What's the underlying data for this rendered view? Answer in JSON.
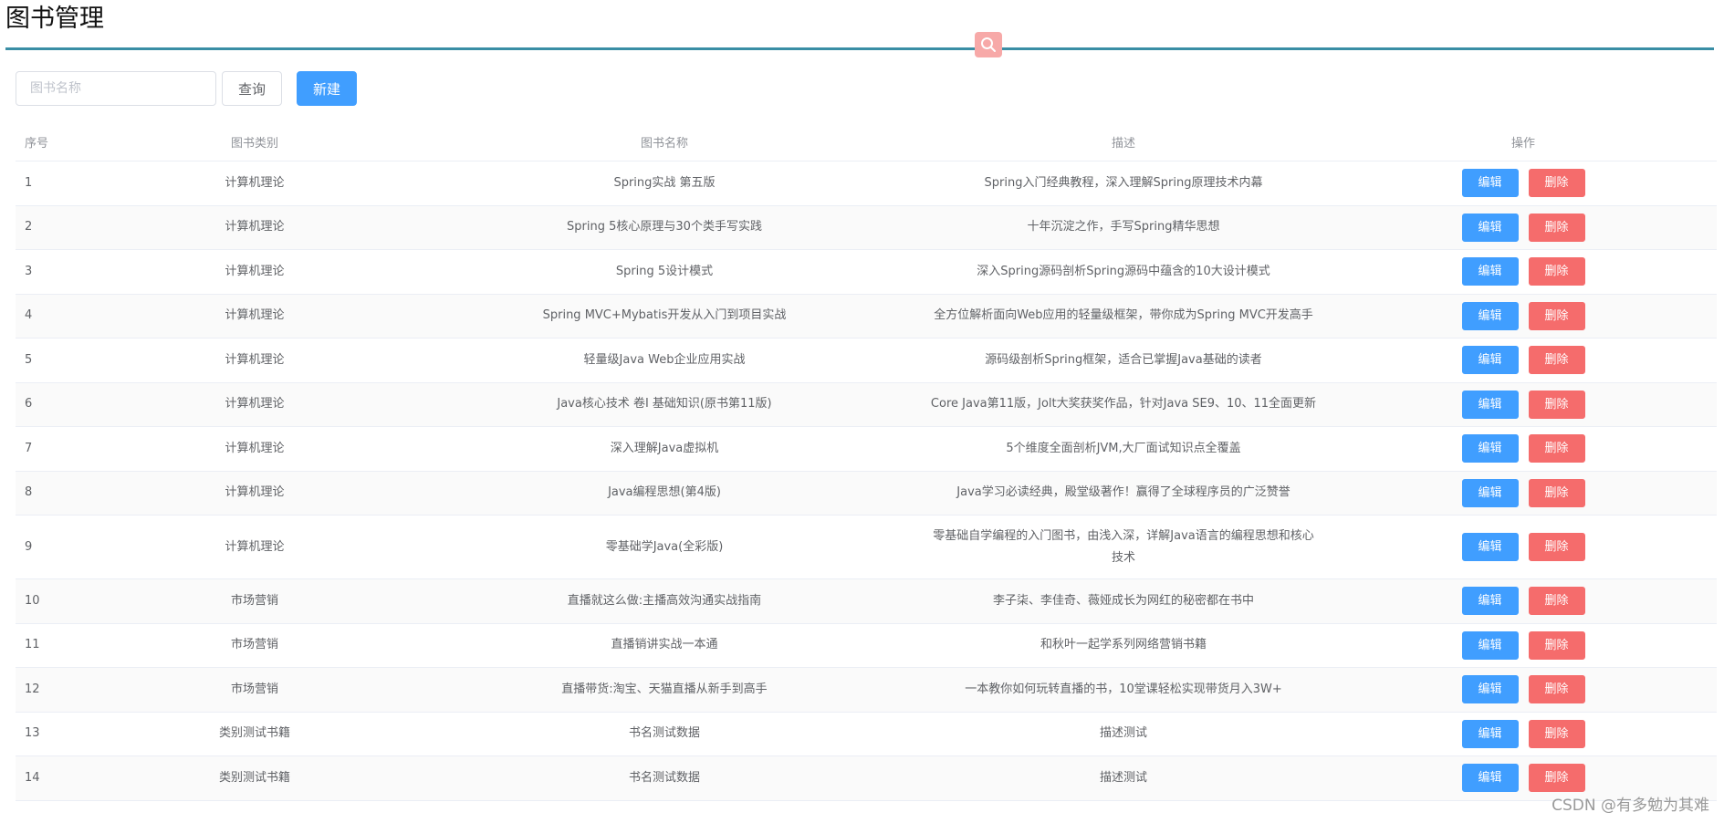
{
  "page": {
    "title": "图书管理"
  },
  "toolbar": {
    "search_placeholder": "图书名称",
    "search_value": "",
    "query_label": "查询",
    "new_label": "新建"
  },
  "table": {
    "columns": [
      "序号",
      "图书类别",
      "图书名称",
      "描述",
      "操作"
    ],
    "edit_label": "编辑",
    "delete_label": "删除",
    "rows": [
      {
        "index": "1",
        "category": "计算机理论",
        "name": "Spring实战 第五版",
        "desc": "Spring入门经典教程，深入理解Spring原理技术内幕"
      },
      {
        "index": "2",
        "category": "计算机理论",
        "name": "Spring 5核心原理与30个类手写实践",
        "desc": "十年沉淀之作，手写Spring精华思想"
      },
      {
        "index": "3",
        "category": "计算机理论",
        "name": "Spring 5设计模式",
        "desc": "深入Spring源码剖析Spring源码中蕴含的10大设计模式"
      },
      {
        "index": "4",
        "category": "计算机理论",
        "name": "Spring MVC+Mybatis开发从入门到项目实战",
        "desc": "全方位解析面向Web应用的轻量级框架，带你成为Spring MVC开发高手"
      },
      {
        "index": "5",
        "category": "计算机理论",
        "name": "轻量级Java Web企业应用实战",
        "desc": "源码级剖析Spring框架，适合已掌握Java基础的读者"
      },
      {
        "index": "6",
        "category": "计算机理论",
        "name": "Java核心技术 卷Ⅰ 基础知识(原书第11版)",
        "desc": "Core Java第11版，Jolt大奖获奖作品，针对Java SE9、10、11全面更新"
      },
      {
        "index": "7",
        "category": "计算机理论",
        "name": "深入理解Java虚拟机",
        "desc": "5个维度全面剖析JVM,大厂面试知识点全覆盖"
      },
      {
        "index": "8",
        "category": "计算机理论",
        "name": "Java编程思想(第4版)",
        "desc": "Java学习必读经典，殿堂级著作！赢得了全球程序员的广泛赞誉"
      },
      {
        "index": "9",
        "category": "计算机理论",
        "name": "零基础学Java(全彩版)",
        "desc": "零基础自学编程的入门图书，由浅入深，详解Java语言的编程思想和核心技术"
      },
      {
        "index": "10",
        "category": "市场营销",
        "name": "直播就这么做:主播高效沟通实战指南",
        "desc": "李子柒、李佳奇、薇娅成长为网红的秘密都在书中"
      },
      {
        "index": "11",
        "category": "市场营销",
        "name": "直播销讲实战一本通",
        "desc": "和秋叶一起学系列网络营销书籍"
      },
      {
        "index": "12",
        "category": "市场营销",
        "name": "直播带货:淘宝、天猫直播从新手到高手",
        "desc": "一本教你如何玩转直播的书，10堂课轻松实现带货月入3W+"
      },
      {
        "index": "13",
        "category": "类别测试书籍",
        "name": "书名测试数据",
        "desc": "描述测试"
      },
      {
        "index": "14",
        "category": "类别测试书籍",
        "name": "书名测试数据",
        "desc": "描述测试"
      }
    ]
  },
  "watermark": {
    "text": "CSDN @有多勉为其难"
  },
  "colors": {
    "primary": "#409eff",
    "danger": "#f56c6c",
    "title_rule": "#3a8ea5",
    "search_float": "#f7a9a8"
  },
  "icons": {
    "search_float": "search-icon"
  }
}
